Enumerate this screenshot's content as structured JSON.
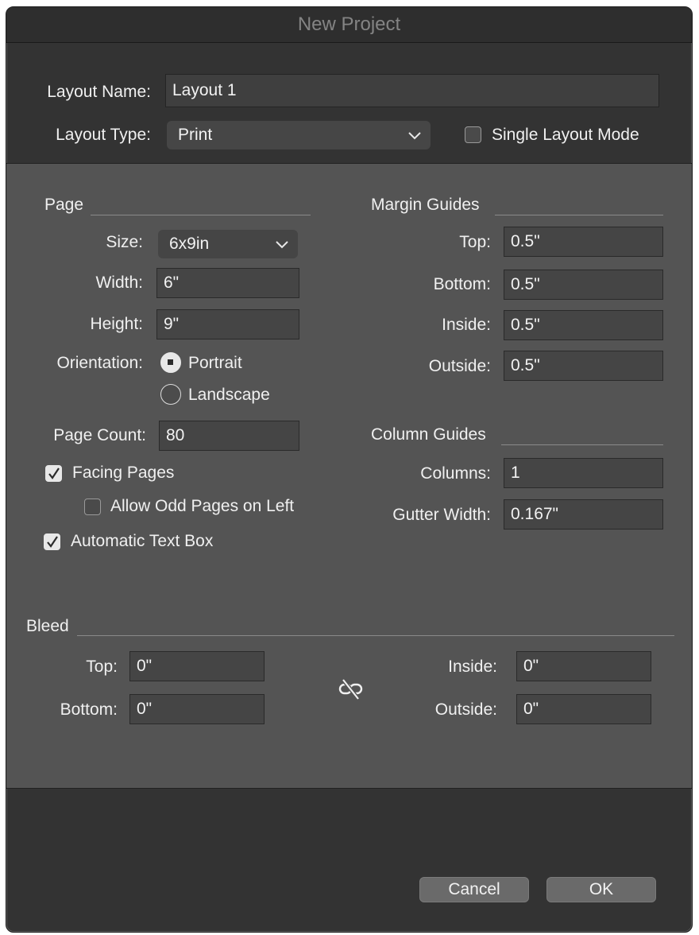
{
  "window": {
    "title": "New Project"
  },
  "layout": {
    "name_label": "Layout Name:",
    "name_value": "Layout 1",
    "type_label": "Layout Type:",
    "type_value": "Print",
    "single_mode_label": "Single Layout Mode",
    "single_mode_checked": false
  },
  "page": {
    "heading": "Page",
    "size_label": "Size:",
    "size_value": "6x9in",
    "width_label": "Width:",
    "width_value": "6\"",
    "height_label": "Height:",
    "height_value": "9\"",
    "orientation_label": "Orientation:",
    "portrait_label": "Portrait",
    "landscape_label": "Landscape",
    "orientation_selected": "Portrait",
    "page_count_label": "Page Count:",
    "page_count_value": "80",
    "facing_pages_label": "Facing Pages",
    "facing_pages_checked": true,
    "allow_odd_label": "Allow Odd Pages on Left",
    "allow_odd_checked": false,
    "auto_text_label": "Automatic Text Box",
    "auto_text_checked": true
  },
  "margin_guides": {
    "heading": "Margin Guides",
    "top_label": "Top:",
    "top_value": "0.5\"",
    "bottom_label": "Bottom:",
    "bottom_value": "0.5\"",
    "inside_label": "Inside:",
    "inside_value": "0.5\"",
    "outside_label": "Outside:",
    "outside_value": "0.5\""
  },
  "column_guides": {
    "heading": "Column Guides",
    "columns_label": "Columns:",
    "columns_value": "1",
    "gutter_label": "Gutter Width:",
    "gutter_value": "0.167\""
  },
  "bleed": {
    "heading": "Bleed",
    "top_label": "Top:",
    "top_value": "0\"",
    "bottom_label": "Bottom:",
    "bottom_value": "0\"",
    "inside_label": "Inside:",
    "inside_value": "0\"",
    "outside_label": "Outside:",
    "outside_value": "0\"",
    "link_icon": "unlink-icon"
  },
  "buttons": {
    "cancel": "Cancel",
    "ok": "OK"
  }
}
